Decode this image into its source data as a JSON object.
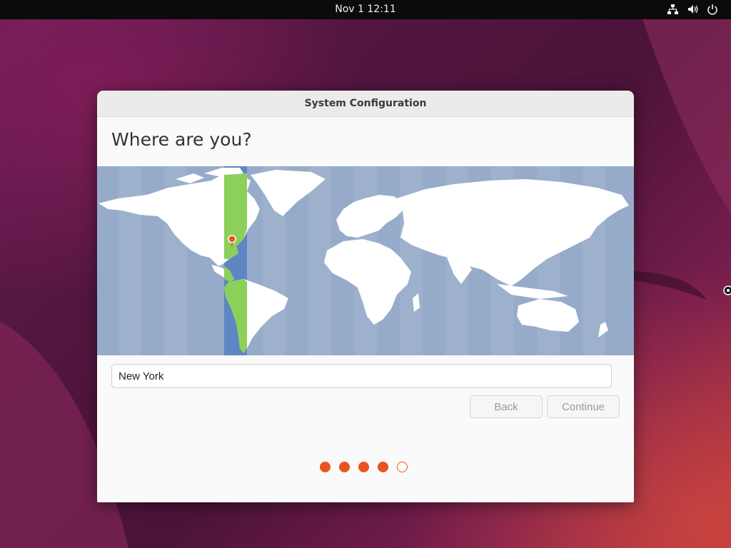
{
  "topbar": {
    "clock": "Nov 1  12:11",
    "icons": [
      "network-icon",
      "volume-icon",
      "power-icon"
    ]
  },
  "dialog": {
    "title": "System Configuration",
    "heading": "Where are you?",
    "timezone_input": {
      "value": "New York"
    },
    "back_label": "Back",
    "continue_label": "Continue",
    "progress": {
      "total_steps": 5,
      "completed_steps": 4
    }
  },
  "colors": {
    "accent": "#e95420",
    "map_ocean": "#96abc9",
    "map_land": "#ffffff",
    "timezone_highlight": "#8cd05a",
    "timezone_band": "#5f86c2"
  }
}
